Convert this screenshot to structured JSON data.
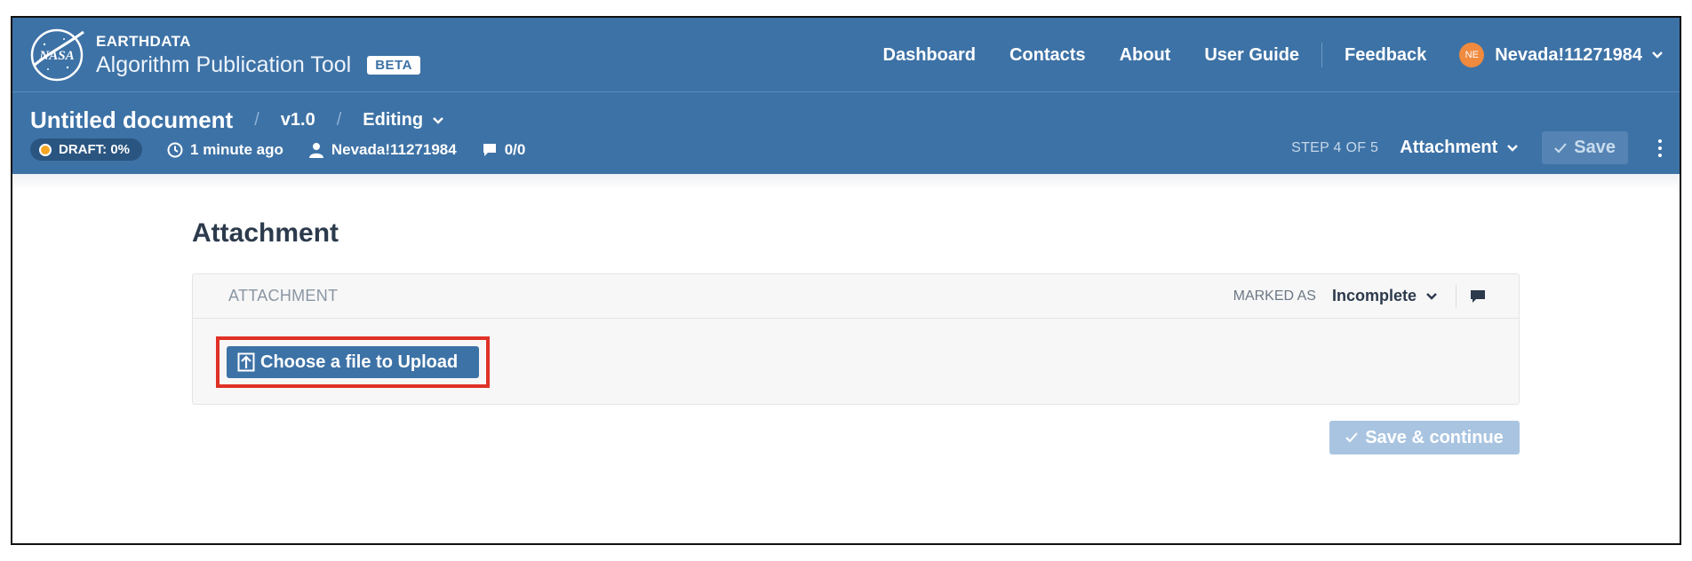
{
  "header": {
    "brand_top": "EARTHDATA",
    "brand_name": "Algorithm Publication Tool",
    "beta_label": "BETA",
    "nav_items": [
      "Dashboard",
      "Contacts",
      "About",
      "User Guide",
      "Feedback"
    ],
    "user": {
      "initials": "NE",
      "name": "Nevada!11271984"
    }
  },
  "document": {
    "title": "Untitled document",
    "version": "v1.0",
    "mode": "Editing",
    "draft_label": "DRAFT: 0%",
    "last_saved": "1 minute ago",
    "owner": "Nevada!11271984",
    "comments": "0/0",
    "step_label": "STEP 4 OF 5",
    "step_name": "Attachment",
    "save_label": "Save"
  },
  "main": {
    "heading": "Attachment",
    "panel": {
      "title": "ATTACHMENT",
      "marked_as_label": "MARKED AS",
      "status": "Incomplete",
      "upload_label": "Choose a file to Upload"
    },
    "continue_label": "Save & continue"
  },
  "colors": {
    "header_bg": "#3d72a6",
    "accent": "#3d72a6",
    "draft_dot": "#f5a623",
    "avatar": "#f08a3e",
    "highlight": "#e03127",
    "disabled_button": "#a9c4e0"
  }
}
